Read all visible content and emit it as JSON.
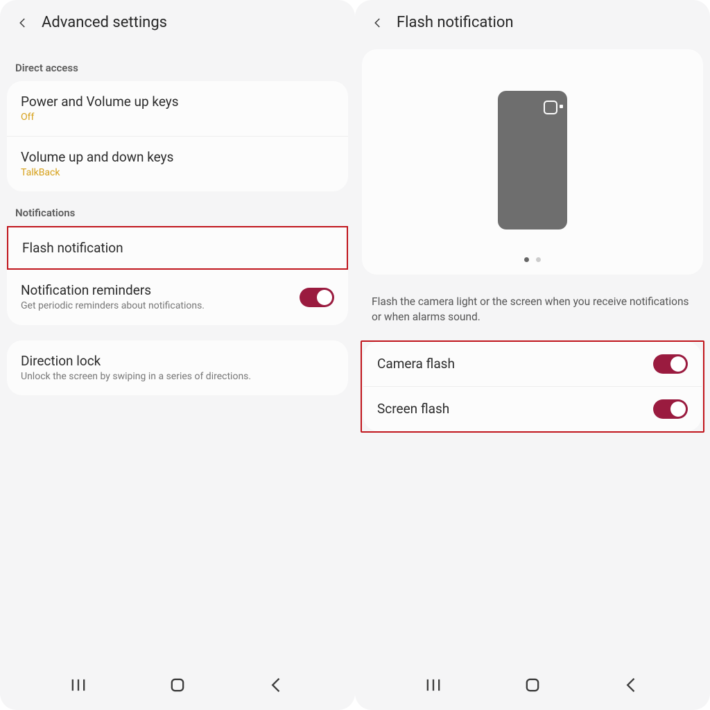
{
  "left": {
    "title": "Advanced settings",
    "sections": {
      "direct_access_label": "Direct access",
      "direct_access": [
        {
          "title": "Power and Volume up keys",
          "sub": "Off"
        },
        {
          "title": "Volume up and down keys",
          "sub": "TalkBack"
        }
      ],
      "notifications_label": "Notifications",
      "flash_notification": "Flash notification",
      "reminders_title": "Notification reminders",
      "reminders_sub": "Get periodic reminders about notifications.",
      "direction_title": "Direction lock",
      "direction_sub": "Unlock the screen by swiping in a series of directions."
    }
  },
  "right": {
    "title": "Flash notification",
    "desc": "Flash the camera light or the screen when you receive notifications or when alarms sound.",
    "camera_flash": "Camera flash",
    "screen_flash": "Screen flash"
  }
}
